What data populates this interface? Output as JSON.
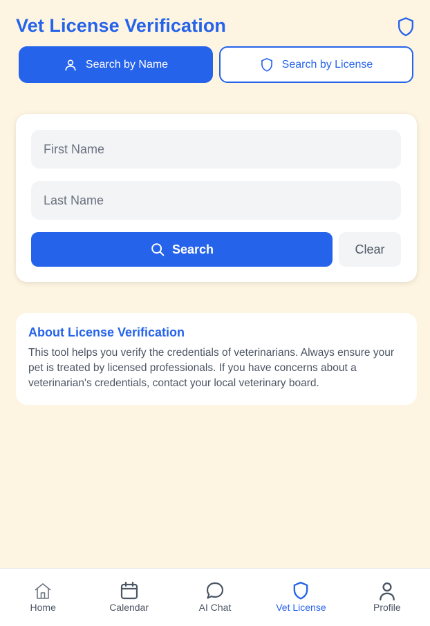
{
  "header": {
    "title": "Vet License Verification",
    "icon": "shield-icon"
  },
  "tabs": [
    {
      "label": "Search by Name",
      "icon": "user-icon",
      "active": true
    },
    {
      "label": "Search by License",
      "icon": "shield-icon",
      "active": false
    }
  ],
  "search_form": {
    "first_name": {
      "value": "",
      "placeholder": "First Name"
    },
    "last_name": {
      "value": "",
      "placeholder": "Last Name"
    },
    "search_label": "Search",
    "search_icon": "search-icon",
    "clear_label": "Clear"
  },
  "about": {
    "title": "About License Verification",
    "body": "This tool helps you verify the credentials of veterinarians. Always ensure your pet is treated by licensed professionals. If you have concerns about a veterinarian's credentials, contact your local veterinary board."
  },
  "bottom_nav": [
    {
      "label": "Home",
      "icon": "home-icon",
      "active": false
    },
    {
      "label": "Calendar",
      "icon": "calendar-icon",
      "active": false
    },
    {
      "label": "AI Chat",
      "icon": "chat-bubble-icon",
      "active": false
    },
    {
      "label": "Vet License",
      "icon": "shield-icon",
      "active": true
    },
    {
      "label": "Profile",
      "icon": "user-icon",
      "active": false
    }
  ],
  "colors": {
    "primary": "#2563eb",
    "background": "#fdf4e1",
    "card": "#ffffff",
    "input": "#f3f4f6",
    "muted_text": "#4b5563"
  }
}
